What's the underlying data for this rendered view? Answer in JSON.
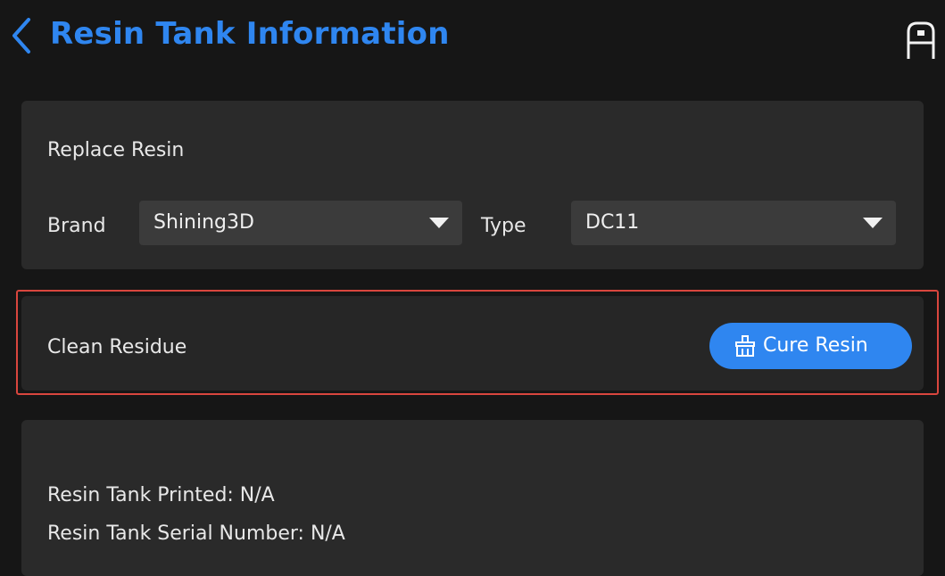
{
  "header": {
    "title": "Resin Tank Information",
    "back_icon": "chevron-left-icon",
    "right_icon": "resin-tank-icon",
    "accent_color": "#2f86f0"
  },
  "replace_resin": {
    "section_title": "Replace Resin",
    "brand_label": "Brand",
    "brand_value": "Shining3D",
    "type_label": "Type",
    "type_value": "DC11"
  },
  "clean_residue": {
    "label": "Clean Residue",
    "button_label": "Cure Resin",
    "button_icon": "brush-icon"
  },
  "tank_info": {
    "printed": "Resin Tank Printed: N/A",
    "serial": "Resin Tank Serial Number: N/A"
  }
}
